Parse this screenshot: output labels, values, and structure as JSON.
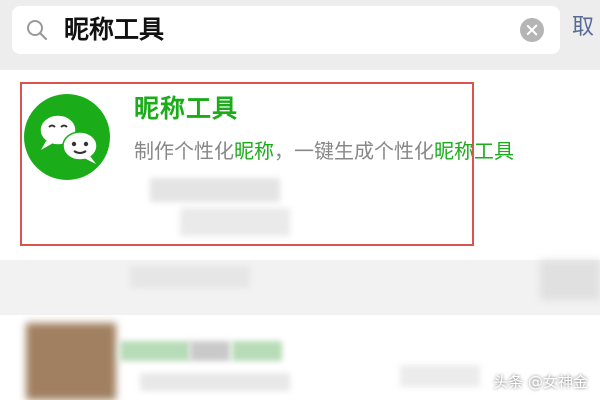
{
  "search": {
    "query": "昵称工具",
    "cancel_label": "取"
  },
  "result": {
    "title": "昵称工具",
    "description": {
      "part1": "制作个性化",
      "hl1": "昵称",
      "part2": "，一键生成个性化",
      "hl2": "昵称工具"
    }
  },
  "watermark": "头条 @女神金",
  "colors": {
    "brand_green": "#1aad19",
    "highlight_border": "#d9534f",
    "link_blue": "#576b95"
  },
  "icons": {
    "search": "search-icon",
    "clear": "clear-icon",
    "avatar": "wechat-chat-bubbles-icon"
  }
}
